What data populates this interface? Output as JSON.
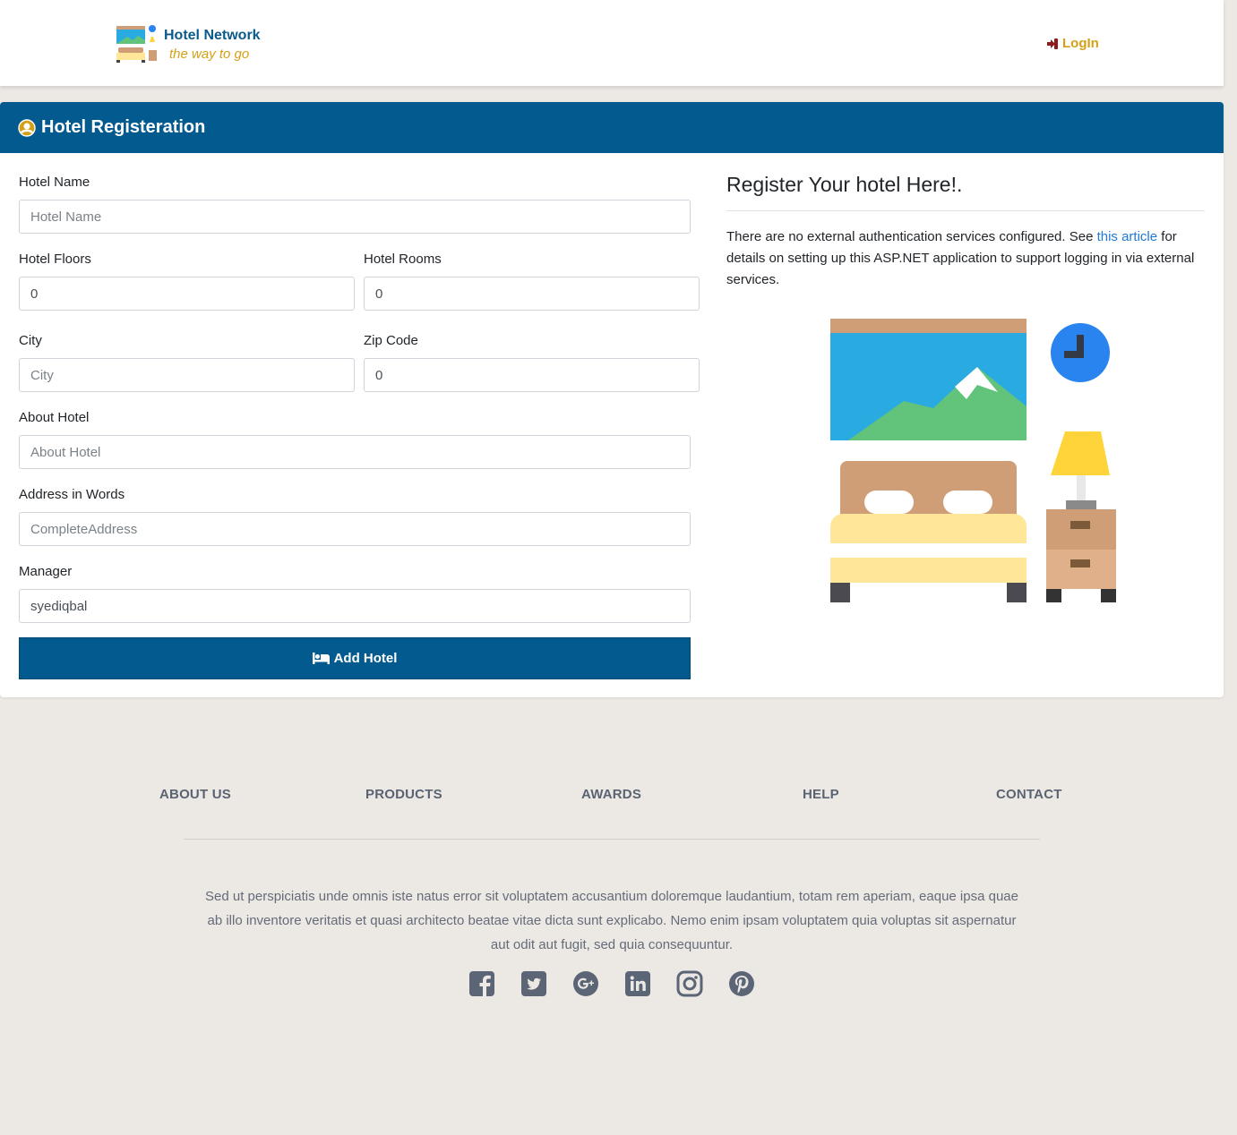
{
  "navbar": {
    "brand_title": "Hotel Network",
    "brand_tagline": "the way to go",
    "login_label": "LogIn",
    "colors": {
      "brand": "#0a5a8c",
      "accent": "#d4a017"
    }
  },
  "card": {
    "header_title": "Hotel Registeration",
    "header_icon": "user-circle-icon",
    "header_color": "#035a8f"
  },
  "form": {
    "hotel_name": {
      "label": "Hotel Name",
      "placeholder": "Hotel Name",
      "value": ""
    },
    "hotel_floors": {
      "label": "Hotel Floors",
      "value": "0"
    },
    "hotel_rooms": {
      "label": "Hotel Rooms",
      "value": "0"
    },
    "city": {
      "label": "City",
      "placeholder": "City",
      "value": ""
    },
    "zip_code": {
      "label": "Zip Code",
      "value": "0"
    },
    "about_hotel": {
      "label": "About Hotel",
      "placeholder": "About Hotel",
      "value": ""
    },
    "address": {
      "label": "Address in Words",
      "placeholder": "CompleteAddress",
      "value": ""
    },
    "manager": {
      "label": "Manager",
      "value": "syediqbal"
    },
    "submit_label": "Add Hotel",
    "submit_icon": "bed-icon"
  },
  "side": {
    "title": "Register Your hotel Here!.",
    "text_before": "There are no external authentication services configured. See ",
    "link_text": "this article",
    "text_after": " for details on setting up this ASP.NET application to support logging in via external services.",
    "illustration": "hotel-room-illustration"
  },
  "footer": {
    "nav": [
      "ABOUT US",
      "PRODUCTS",
      "AWARDS",
      "HELP",
      "CONTACT"
    ],
    "text": "Sed ut perspiciatis unde omnis iste natus error sit voluptatem accusantium doloremque laudantium, totam rem aperiam, eaque ipsa quae ab illo inventore veritatis et quasi architecto beatae vitae dicta sunt explicabo. Nemo enim ipsam voluptatem quia voluptas sit aspernatur aut odit aut fugit, sed quia consequuntur.",
    "socials": [
      "facebook-icon",
      "twitter-icon",
      "google-plus-icon",
      "linkedin-icon",
      "instagram-icon",
      "pinterest-icon"
    ]
  }
}
